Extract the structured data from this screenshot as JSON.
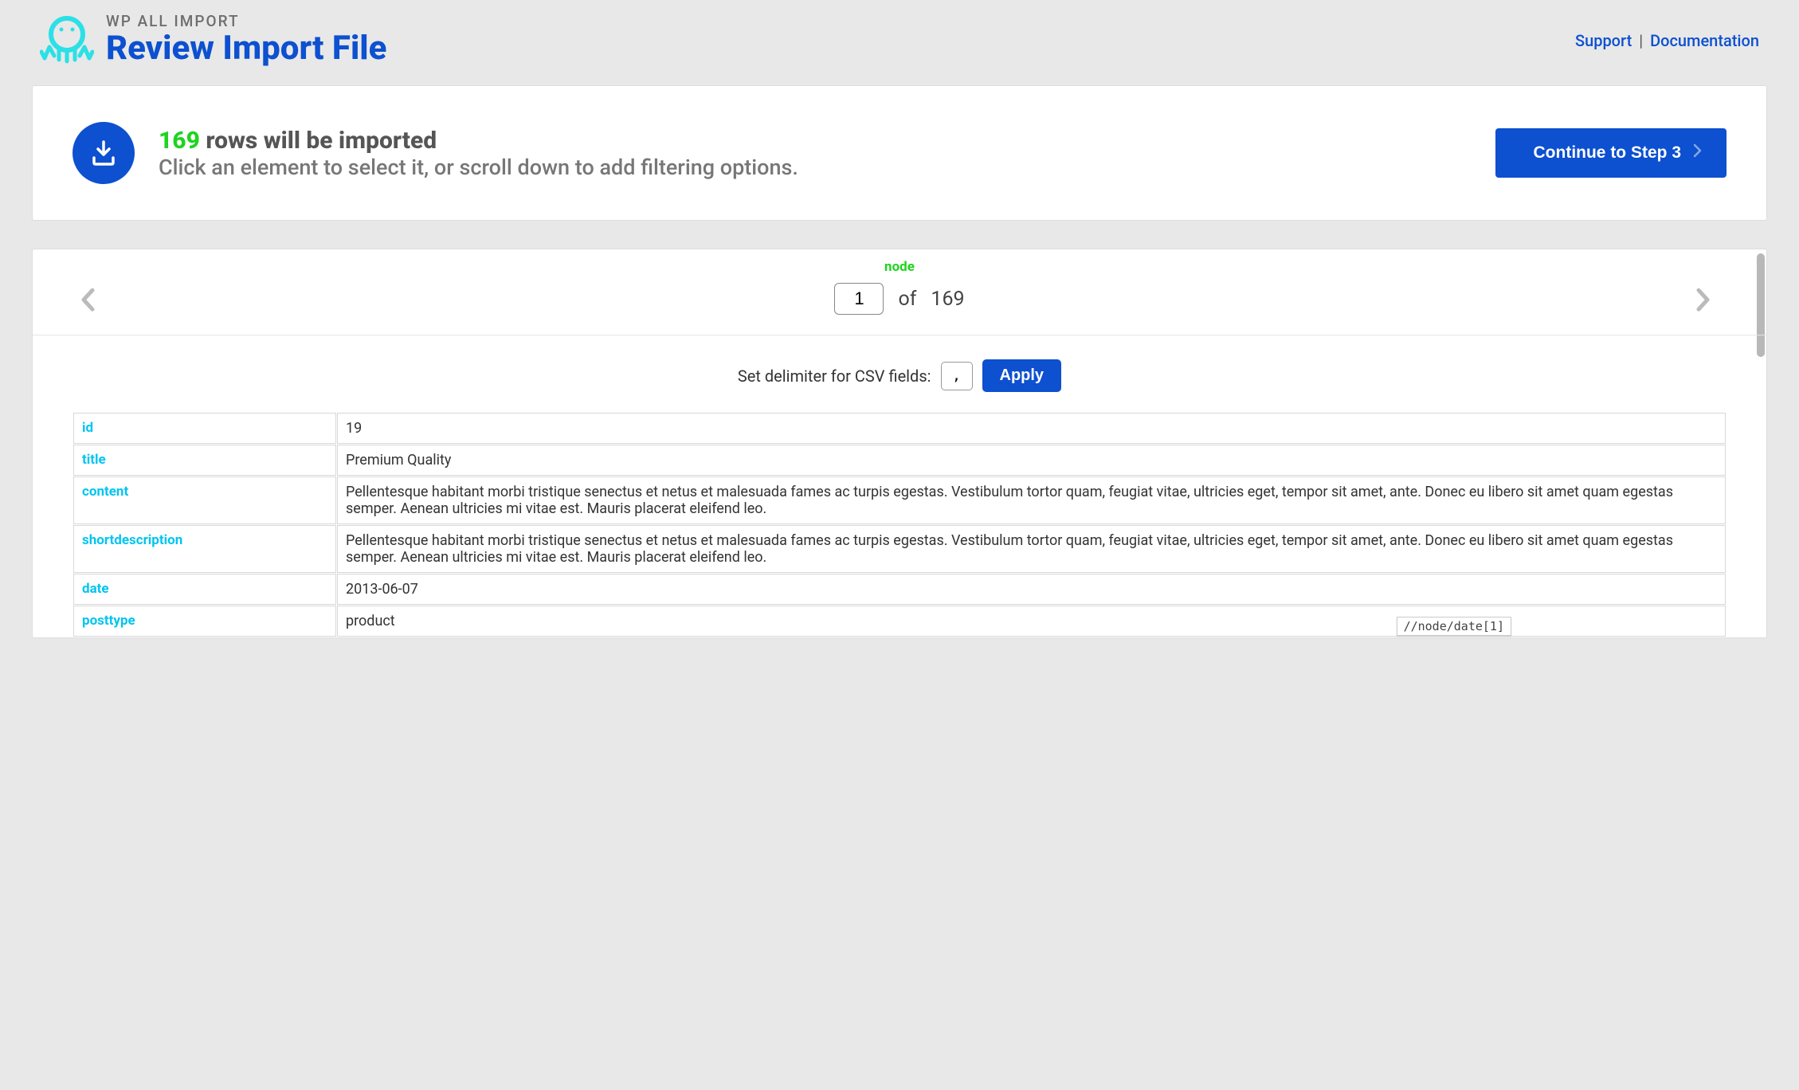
{
  "brand": "WP ALL IMPORT",
  "page_title": "Review Import File",
  "header_links": {
    "support": "Support",
    "documentation": "Documentation"
  },
  "summary": {
    "count": "169",
    "count_suffix": "rows will be imported",
    "subtext": "Click an element to select it, or scroll down to add filtering options.",
    "continue_label": "Continue to Step 3"
  },
  "pager": {
    "node_label": "node",
    "current": "1",
    "of_label": "of",
    "total": "169"
  },
  "delimiter": {
    "label": "Set delimiter for CSV fields:",
    "value": ",",
    "apply_label": "Apply"
  },
  "fields": [
    {
      "key": "id",
      "value": "19"
    },
    {
      "key": "title",
      "value": "Premium Quality"
    },
    {
      "key": "content",
      "value": "Pellentesque habitant morbi tristique senectus et netus et malesuada fames ac turpis egestas. Vestibulum tortor quam, feugiat vitae, ultricies eget, tempor sit amet, ante. Donec eu libero sit amet quam egestas semper. Aenean ultricies mi vitae est. Mauris placerat eleifend leo."
    },
    {
      "key": "shortdescription",
      "value": "Pellentesque habitant morbi tristique senectus et netus et malesuada fames ac turpis egestas. Vestibulum tortor quam, feugiat vitae, ultricies eget, tempor sit amet, ante. Donec eu libero sit amet quam egestas semper. Aenean ultricies mi vitae est. Mauris placerat eleifend leo."
    },
    {
      "key": "date",
      "value": "2013-06-07"
    },
    {
      "key": "posttype",
      "value": "product"
    }
  ],
  "tooltip": "//node/date[1]"
}
